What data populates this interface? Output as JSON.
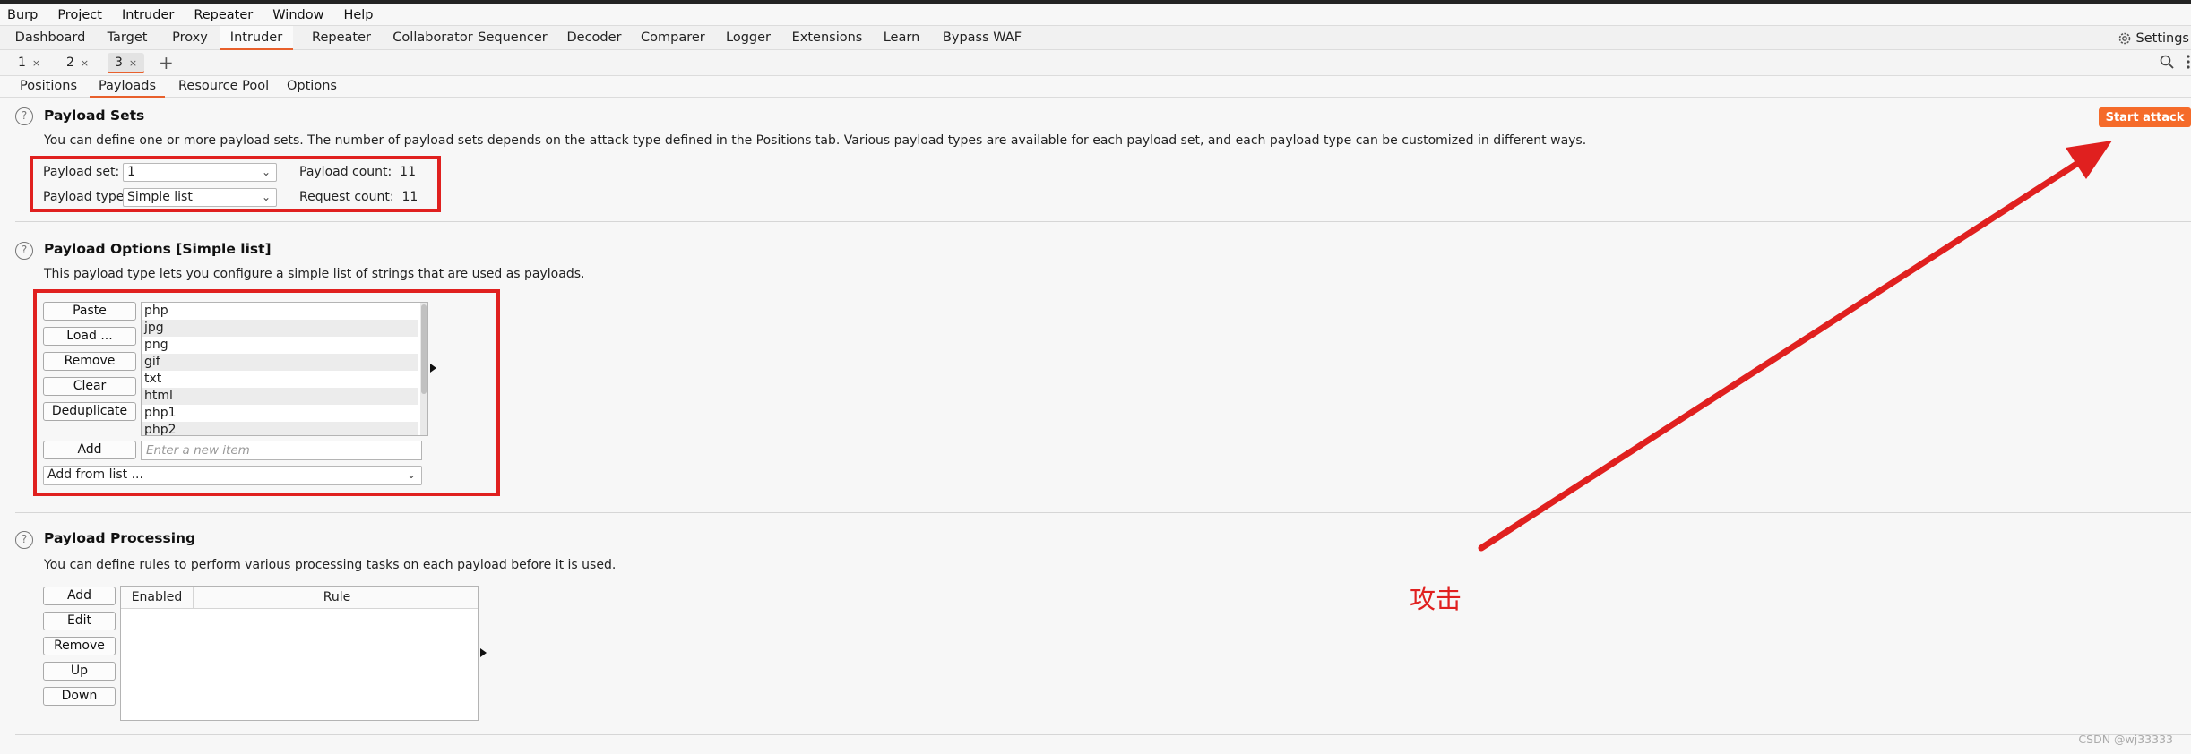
{
  "menubar": [
    "Burp",
    "Project",
    "Intruder",
    "Repeater",
    "Window",
    "Help"
  ],
  "tool_tabs": [
    "Dashboard",
    "Target",
    "Proxy",
    "Intruder",
    "Repeater",
    "Collaborator",
    "Sequencer",
    "Decoder",
    "Comparer",
    "Logger",
    "Extensions",
    "Learn",
    "Bypass WAF"
  ],
  "active_tool_tab": "Intruder",
  "settings_label": "Settings",
  "instance_tabs": [
    {
      "label": "1",
      "close": "×"
    },
    {
      "label": "2",
      "close": "×"
    },
    {
      "label": "3",
      "close": "×"
    }
  ],
  "add_tab": "+",
  "sub_tabs": [
    "Positions",
    "Payloads",
    "Resource Pool",
    "Options"
  ],
  "active_sub_tab": "Payloads",
  "help_glyph": "?",
  "payload_sets": {
    "title": "Payload Sets",
    "desc": "You can define one or more payload sets. The number of payload sets depends on the attack type defined in the Positions tab. Various payload types are available for each payload set, and each payload type can be customized in different ways.",
    "set_label": "Payload set:",
    "set_value": "1",
    "type_label": "Payload type:",
    "type_value": "Simple list",
    "count_label": "Payload count:",
    "count_value": "11",
    "request_label": "Request count:",
    "request_value": "11",
    "start_attack": "Start attack"
  },
  "payload_options": {
    "title": "Payload Options [Simple list]",
    "desc": "This payload type lets you configure a simple list of strings that are used as payloads.",
    "buttons": [
      "Paste",
      "Load ...",
      "Remove",
      "Clear",
      "Deduplicate"
    ],
    "items": [
      "php",
      "jpg",
      "png",
      "gif",
      "txt",
      "html",
      "php1",
      "php2"
    ],
    "add_button": "Add",
    "add_placeholder": "Enter a new item",
    "add_from_list": "Add from list ..."
  },
  "payload_processing": {
    "title": "Payload Processing",
    "desc": "You can define rules to perform various processing tasks on each payload before it is used.",
    "buttons": [
      "Add",
      "Edit",
      "Remove",
      "Up",
      "Down"
    ],
    "columns": [
      "Enabled",
      "Rule"
    ]
  },
  "annotation": "攻击",
  "watermark": "CSDN @wj33333",
  "colors": {
    "accent": "#e8602c",
    "start_button": "#f56b2a",
    "annotation_red": "#e0201f"
  }
}
